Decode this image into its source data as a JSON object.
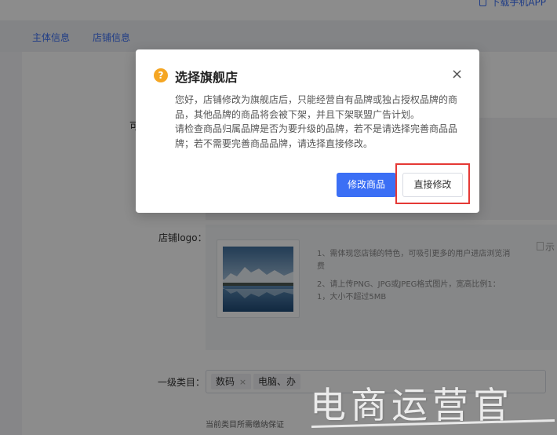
{
  "topbar": {
    "download_app": "下载手机APP"
  },
  "subnav": {
    "tabs": [
      {
        "label": "主体信息"
      },
      {
        "label": "店铺信息"
      }
    ]
  },
  "form": {
    "partial_label": "可",
    "logo": {
      "label": "店铺logo：",
      "hint_1": "1、需体现您店铺的特色，可吸引更多的用户进店浏览消费",
      "hint_2": "2、请上传PNG、JPG或JPEG格式图片，宽高比例1：1，大小不超过5MB",
      "example_alt": "示"
    },
    "category": {
      "label": "一级类目：",
      "tags": [
        {
          "label": "数码",
          "remove": "×"
        },
        {
          "label": "电脑、办"
        }
      ],
      "deposit_note": "当前类目所需缴纳保证"
    }
  },
  "modal": {
    "icon": "warning-icon",
    "icon_glyph": "?",
    "title": "选择旗舰店",
    "close": "×",
    "paragraph_1": "您好，店铺修改为旗舰店后，只能经营自有品牌或独占授权品牌的商品，其他品牌的商品将会被下架，并且下架联盟广告计划。",
    "paragraph_2": "请检查商品归属品牌是否为要升级的品牌，若不是请选择完善商品品牌；若不需要完善商品品牌，请选择直接修改。",
    "btn_edit_products": "修改商品",
    "btn_direct_edit": "直接修改"
  },
  "watermark": {
    "text": "电商运营官"
  },
  "colors": {
    "primary": "#3b6ff5",
    "warning": "#f5a623",
    "highlight": "#e53935"
  }
}
